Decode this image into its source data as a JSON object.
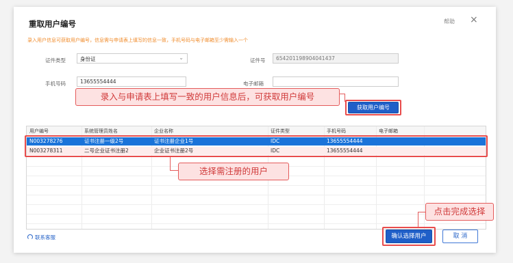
{
  "dialog": {
    "title": "重取用户编号",
    "help_label": "帮助",
    "close_glyph": "×",
    "notice": "录入用户信息可获取用户编号，信息需与申请表上填写的信息一致，手机号码与电子邮箱至少需输入一个"
  },
  "form": {
    "id_type_label": "证件类型",
    "id_type_value": "身份证",
    "id_number_label": "证件号",
    "id_number_value": "654201198904041437",
    "phone_label": "手机号码",
    "phone_value": "13655554444",
    "email_label": "电子邮箱",
    "email_value": ""
  },
  "get_button_label": "获取用户编号",
  "callouts": {
    "top": "录入与申请表上填写一致的用户信息后，可获取用户编号",
    "middle": "选择需注册的用户",
    "bottom": "点击完成选择"
  },
  "table": {
    "columns": [
      "用户编号",
      "系统管理员姓名",
      "企业名称",
      "证件类型",
      "手机号码",
      "电子邮箱"
    ],
    "rows": [
      {
        "user_id": "N003278276",
        "admin_name": "证书注册一级2号",
        "company": "证书注册企业1号",
        "id_type": "IDC",
        "phone": "13655554444",
        "email": ""
      },
      {
        "user_id": "N003278311",
        "admin_name": "二号企业证书注册2",
        "company": "企业证书注册2号",
        "id_type": "IDC",
        "phone": "13655554444",
        "email": ""
      }
    ]
  },
  "footer": {
    "contact_icon": "headset-icon",
    "contact_label": "联系客服",
    "confirm_label": "确认选择用户",
    "cancel_label": "取 消"
  },
  "colors": {
    "accent_blue": "#1f5fc8",
    "selected_row": "#1a73d9",
    "callout_red": "#e45a5a",
    "notice_orange": "#f08c2c"
  }
}
